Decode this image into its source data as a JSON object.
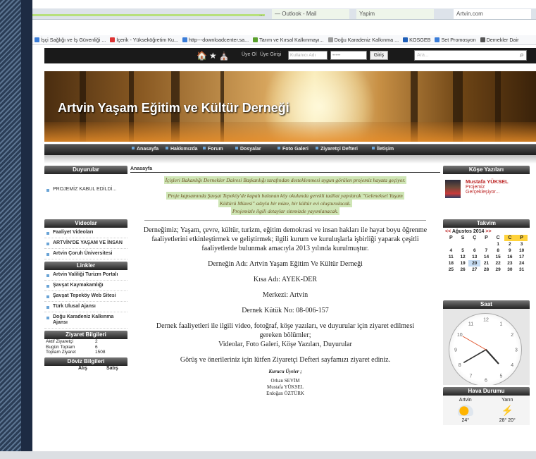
{
  "browser": {
    "tabs": [
      {
        "label": "..."
      },
      {
        "label": "—  Outlook - Mail"
      },
      {
        "label": "Yapim"
      },
      {
        "label": "Artvin.com"
      }
    ],
    "bookmarks": [
      {
        "label": "İşçi Sağlığı ve İş Güvenliği ...",
        "color": "#3b7dd8"
      },
      {
        "label": "İçerik - Yükseköğretim Ku...",
        "color": "#d33"
      },
      {
        "label": "http---downloadcenter.sa...",
        "color": "#3b7dd8"
      },
      {
        "label": "Tarım ve Kırsal Kalkınmayı...",
        "color": "#5aa02c"
      },
      {
        "label": "Doğu Karadeniz Kalkınma ...",
        "color": "#999"
      },
      {
        "label": "KOSGEB",
        "color": "#1f5fb8"
      },
      {
        "label": "Set Promosyon",
        "color": "#3b7dd8"
      },
      {
        "label": "Demekler Dair",
        "color": "#555"
      }
    ]
  },
  "topbar": {
    "icons": "🏠★⛪",
    "signup": "Üye Ol",
    "login": "Üye Girişi",
    "username_placeholder": "Kullanıcı Adı",
    "password_placeholder": "•••••",
    "login_button": "Giriş",
    "search_placeholder": "Ara...",
    "search_icon": "search-icon"
  },
  "banner": {
    "title": "Artvin Yaşam Eğitim ve Kültür Derneği"
  },
  "nav": {
    "items": [
      "Anasayfa",
      "Hakkımızda",
      "Forum",
      "Dosyalar",
      "Foto Galeri",
      "Ziyaretçi Defteri",
      "İletişim"
    ]
  },
  "left": {
    "announcements": {
      "title": "Duyurular",
      "items": [
        "PROJEMİZ KABUL EDİLDİ..."
      ]
    },
    "videos": {
      "title": "Videolar",
      "items": [
        "Faaliyet Videoları",
        "ARTVİN'DE YAŞAM VE İNSAN",
        "Artvin Çoruh Üniversitesi"
      ]
    },
    "links": {
      "title": "Linkler",
      "items": [
        "Artvin Valiliği Turizm Portalı",
        "Şavşat Kaymakamlığı",
        "Şavşat Tepeköy Web Sitesi",
        "Türk Ulusal Ajansı",
        "Doğu Karadeniz Kalkınma Ajansı"
      ]
    },
    "visitors": {
      "title": "Ziyaret Bilgileri",
      "rows": [
        {
          "label": "Aktif Ziyaretçi",
          "value": "2"
        },
        {
          "label": "Bugün Toplam",
          "value": "6"
        },
        {
          "label": "Toplam Ziyaret",
          "value": "1508"
        }
      ]
    },
    "currency": {
      "title": "Döviz Bilgileri",
      "buy": "Alış",
      "sell": "Satış"
    }
  },
  "main": {
    "breadcrumb": "Anasayfa",
    "highlight1": "İçişleri Bakanlığı Dernekler Dairesi Başkanlığı tarafından desteklenmesi uygun görülen projemiz hayata geçiyor.",
    "highlight2a": "Proje kapsamında Şavşat Tepeköy'de kapalı bulunan köy okulunda gerekli tadilat yapılarak \"Geleneksel Yaşam",
    "highlight2b": "Kültürü Müzesi\" adıyla bir müze, bir kültür evi oluşturulacak.",
    "highlight2c": "Projemizle ilgili detaylar sitemizde yayımlanacak.",
    "intro": "Derneğimiz; Yaşam, çevre, kültür, turizm, eğitim demokrasi ve insan hakları ile hayat boyu öğrenme faaliyetlerini etkinleştirmek ve geliştirmek; ilgili kurum ve kuruluşlarla işbirliği yaparak çeşitli faaliyetlerde bulunmak amacıyla 2013 yılında kurulmuştur.",
    "name": "Derneğin Adı: Artvin Yaşam Eğitim Ve Kültür Derneği",
    "short": "Kısa Adı: AYEK-DER",
    "center": "Merkezi: Artvin",
    "regno": "Dernek Kütük No: 08-006-157",
    "sections1": "Dernek faaliyetleri ile ilgili video, fotoğraf, köşe yazıları, ve duyurular için ziyaret edilmesi gereken bölümler;",
    "sections2": "Videolar, Foto Galeri, Köşe Yazıları, Duyurular",
    "feedback": "Görüş ve önerileriniz için lütfen Ziyaretçi Defteri sayfamızı ziyaret ediniz.",
    "founders_title": "Kurucu Üyeler ;",
    "founders": [
      "Orhan SEVİM",
      "Mustafa YÜKSEL",
      "Erdoğan ÖZTÜRK"
    ]
  },
  "right": {
    "columns": {
      "title": "Köşe Yazıları",
      "author": "Mustafa YÜKSEL",
      "subtitle1": "Projemiz",
      "subtitle2": "Gerçekleşiyor..."
    },
    "calendar": {
      "title": "Takvim",
      "prev": "<<",
      "month": "Ağustos 2014",
      "next": ">>",
      "days": [
        "P",
        "S",
        "Ç",
        "P",
        "C",
        "C",
        "P"
      ],
      "weeks": [
        [
          "",
          "",
          "",
          "",
          "",
          "1",
          "2",
          "3"
        ],
        [
          "4",
          "5",
          "6",
          "7",
          "8",
          "9",
          "10"
        ],
        [
          "11",
          "12",
          "13",
          "14",
          "15",
          "16",
          "17"
        ],
        [
          "18",
          "19",
          "20",
          "21",
          "22",
          "23",
          "24"
        ],
        [
          "25",
          "26",
          "27",
          "28",
          "29",
          "30",
          "31"
        ]
      ],
      "today": "20"
    },
    "clock": {
      "title": "Saat",
      "hour": 4.6,
      "minute": 40,
      "second": 50
    },
    "weather": {
      "title": "Hava Durumu",
      "cities": [
        {
          "name": "Artvin",
          "temp": "24°"
        },
        {
          "name": "Yarın",
          "temp": "28° 20°"
        }
      ]
    }
  }
}
